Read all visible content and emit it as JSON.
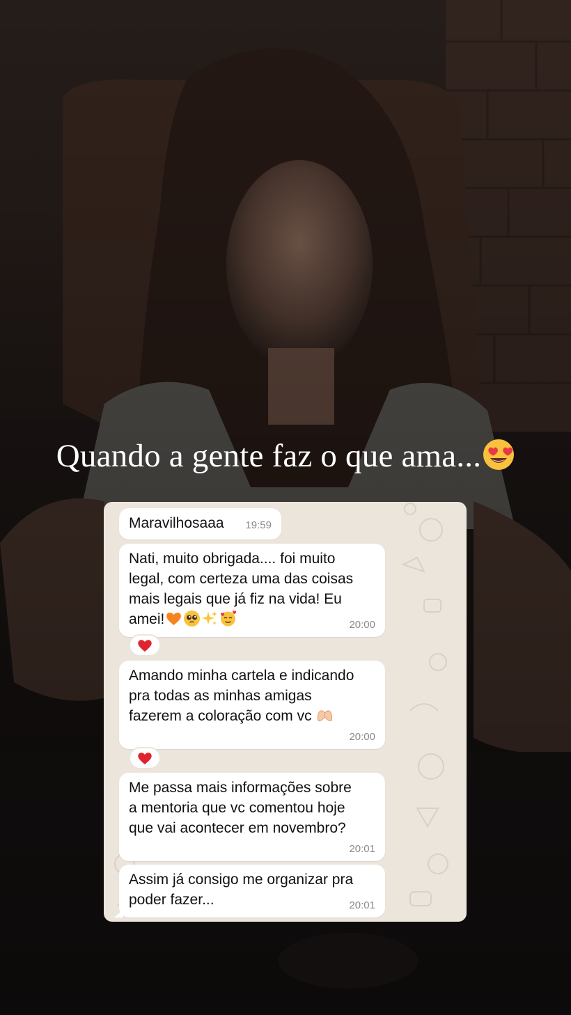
{
  "story": {
    "caption": "Quando a gente faz o que ama...",
    "caption_emoji": "heart-eyes-emoji"
  },
  "chat": {
    "messages": [
      {
        "text": "Maravilhosaaa",
        "time": "19:59",
        "reaction": null
      },
      {
        "text": "Nati, muito obrigada.... foi muito\nlegal, com certeza uma das coisas\nmais legais que já fiz na vida! Eu\namei!",
        "emojis": [
          "orange-heart-emoji",
          "pleading-face-emoji",
          "sparkles-emoji",
          "smiling-face-with-hearts-emoji"
        ],
        "time": "20:00",
        "reaction": "red-heart-emoji"
      },
      {
        "text": "Amando minha cartela e indicando\npra todas as minhas amigas\nfazerem a coloração com vc",
        "emojis": [
          "heart-hands-emoji"
        ],
        "time": "20:00",
        "reaction": "red-heart-emoji"
      },
      {
        "text": "Me passa mais informações sobre\na mentoria que vc comentou hoje\nque vai acontecer em novembro?",
        "time": "20:01",
        "reaction": null
      },
      {
        "text": "Assim já consigo me organizar pra\npoder fazer...",
        "time": "20:01",
        "reaction": null
      }
    ]
  },
  "colors": {
    "chat_background": "#ece5dc",
    "bubble": "#ffffff",
    "timestamp": "#8a8a8a",
    "reaction_heart": "#e0242f",
    "orange_heart": "#f5841f"
  }
}
